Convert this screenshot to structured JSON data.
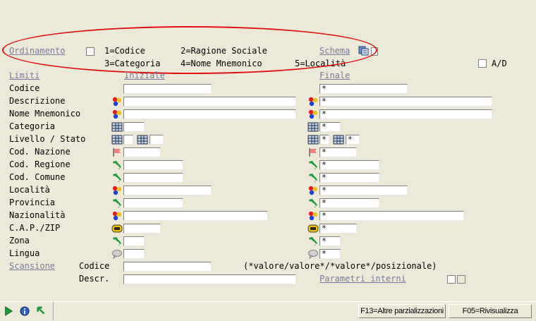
{
  "ordinamento": {
    "label": "Ordinamento",
    "opt1": "1=Codice",
    "opt2": "2=Ragione Sociale",
    "opt3": "3=Categoria",
    "opt4": "4=Nome Mnemonico",
    "opt5": "5=Località"
  },
  "schema_label": "Schema",
  "ad_label": "A/D",
  "limiti": {
    "label": "Limiti",
    "iniziale": "Iniziale",
    "finale": "Finale"
  },
  "rows": [
    {
      "label": "Codice",
      "final": "*"
    },
    {
      "label": "Descrizione",
      "final": "*"
    },
    {
      "label": "Nome Mnemonico",
      "final": "*"
    },
    {
      "label": "Categoria",
      "final": "*"
    },
    {
      "label": "Livello / Stato",
      "final": "*",
      "final2": "*"
    },
    {
      "label": "Cod. Nazione",
      "final": "*"
    },
    {
      "label": "Cod. Regione",
      "final": "*"
    },
    {
      "label": "Cod. Comune",
      "final": "*"
    },
    {
      "label": "Località",
      "final": "*"
    },
    {
      "label": "Provincia",
      "final": "*"
    },
    {
      "label": "Nazionalità",
      "final": "*"
    },
    {
      "label": "C.A.P./ZIP",
      "final": "*"
    },
    {
      "label": "Zona",
      "final": "*"
    },
    {
      "label": "Lingua",
      "final": "*"
    }
  ],
  "scansione": {
    "label": "Scansione",
    "codice": "Codice",
    "descr": "Descr.",
    "hint": "(*valore/valore*/*valore*/posizionale)"
  },
  "parametri_label": "Parametri interni",
  "buttons": {
    "f13": "F13=Altre parzializzazioni",
    "f05": "F05=Rivisualizza"
  },
  "colors": {
    "oval": "#E01010",
    "link": "#7A7A9A",
    "background": "#ECE9D8"
  }
}
